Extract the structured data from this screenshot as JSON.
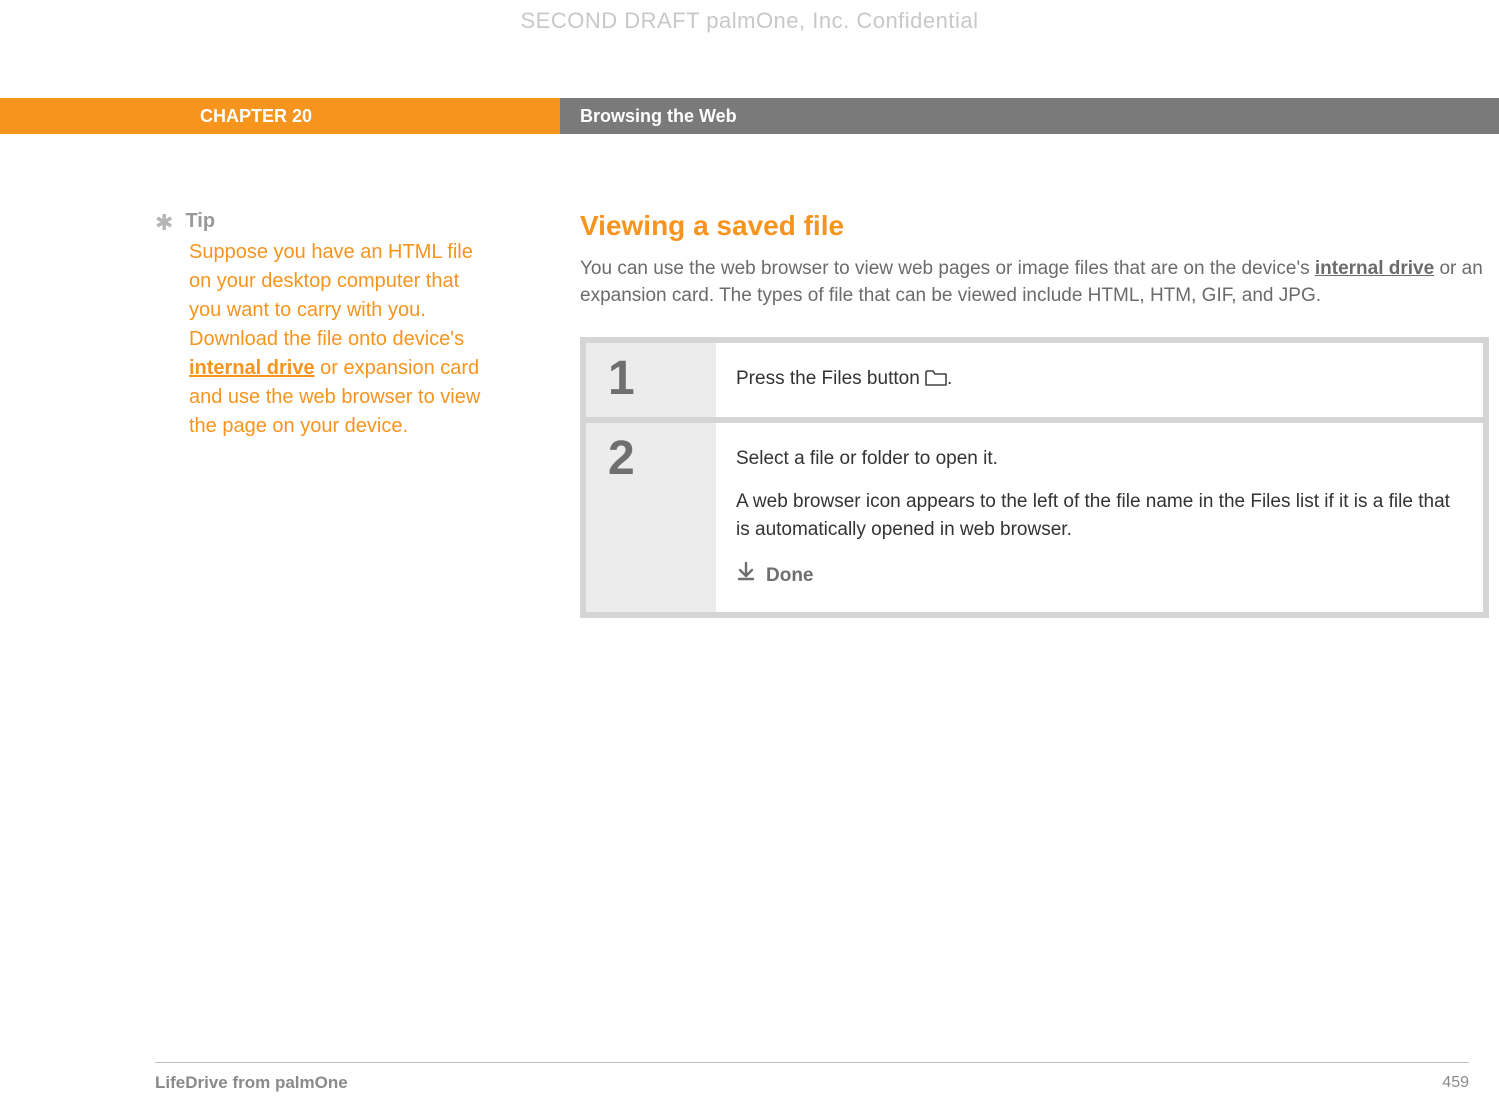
{
  "watermark": "SECOND DRAFT palmOne, Inc.  Confidential",
  "header": {
    "chapter": "CHAPTER 20",
    "title": "Browsing the Web"
  },
  "sidebar": {
    "tip_label": "Tip",
    "tip_part1": "Suppose you have an HTML file on your desktop computer that you want to carry with you. Download the file onto device's ",
    "tip_link": "internal drive",
    "tip_part2": " or expansion card and use the web browser to view the page on your device."
  },
  "main": {
    "section_title": "Viewing a saved file",
    "intro_part1": "You can use the web browser to view web pages or image files that are on the device's ",
    "intro_link": "internal drive",
    "intro_part2": " or an expansion card. The types of file that can be viewed include HTML, HTM, GIF, and JPG.",
    "steps": [
      {
        "num": "1",
        "text_pre": "Press the Files button ",
        "text_post": "."
      },
      {
        "num": "2",
        "line1": "Select a file or folder to open it.",
        "line2": "A web browser icon appears to the left of the file name in the Files list if it is a file that is automatically opened in web browser.",
        "done": "Done"
      }
    ]
  },
  "footer": {
    "product": "LifeDrive from palmOne",
    "page": "459"
  }
}
